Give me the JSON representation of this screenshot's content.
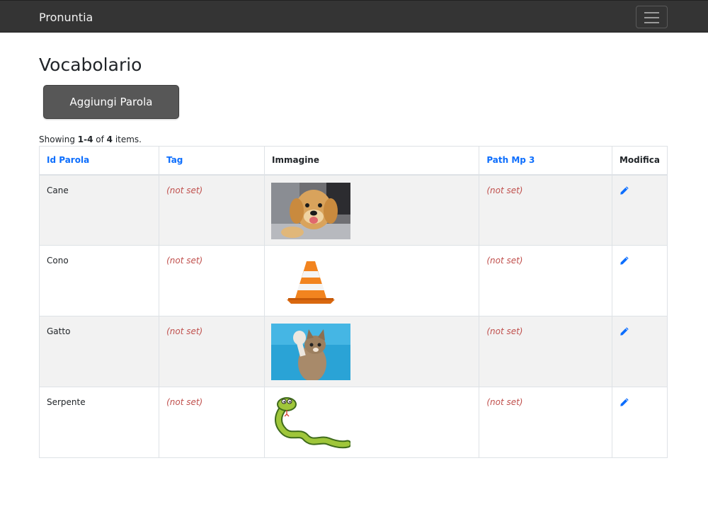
{
  "navbar": {
    "brand": "Pronuntia"
  },
  "page": {
    "title": "Vocabolario",
    "add_button": "Aggiungi Parola"
  },
  "summary": {
    "prefix": "Showing ",
    "range": "1-4",
    "of": " of ",
    "total": "4",
    "suffix": " items."
  },
  "table": {
    "headers": [
      "Id Parola",
      "Tag",
      "Immagine",
      "Path Mp 3",
      "Modifica"
    ],
    "rows": [
      {
        "word": "Cane",
        "tag": "(not set)",
        "image": "puppy-image",
        "path": "(not set)"
      },
      {
        "word": "Cono",
        "tag": "(not set)",
        "image": "traffic-cone-image",
        "path": "(not set)"
      },
      {
        "word": "Gatto",
        "tag": "(not set)",
        "image": "cat-image",
        "path": "(not set)"
      },
      {
        "word": "Serpente",
        "tag": "(not set)",
        "image": "snake-image",
        "path": "(not set)"
      }
    ]
  },
  "colors": {
    "link": "#0d6efd",
    "not_set": "#c0504d",
    "navbar": "#343434"
  },
  "icons": {
    "edit": "pencil-icon",
    "menu": "hamburger-icon"
  }
}
